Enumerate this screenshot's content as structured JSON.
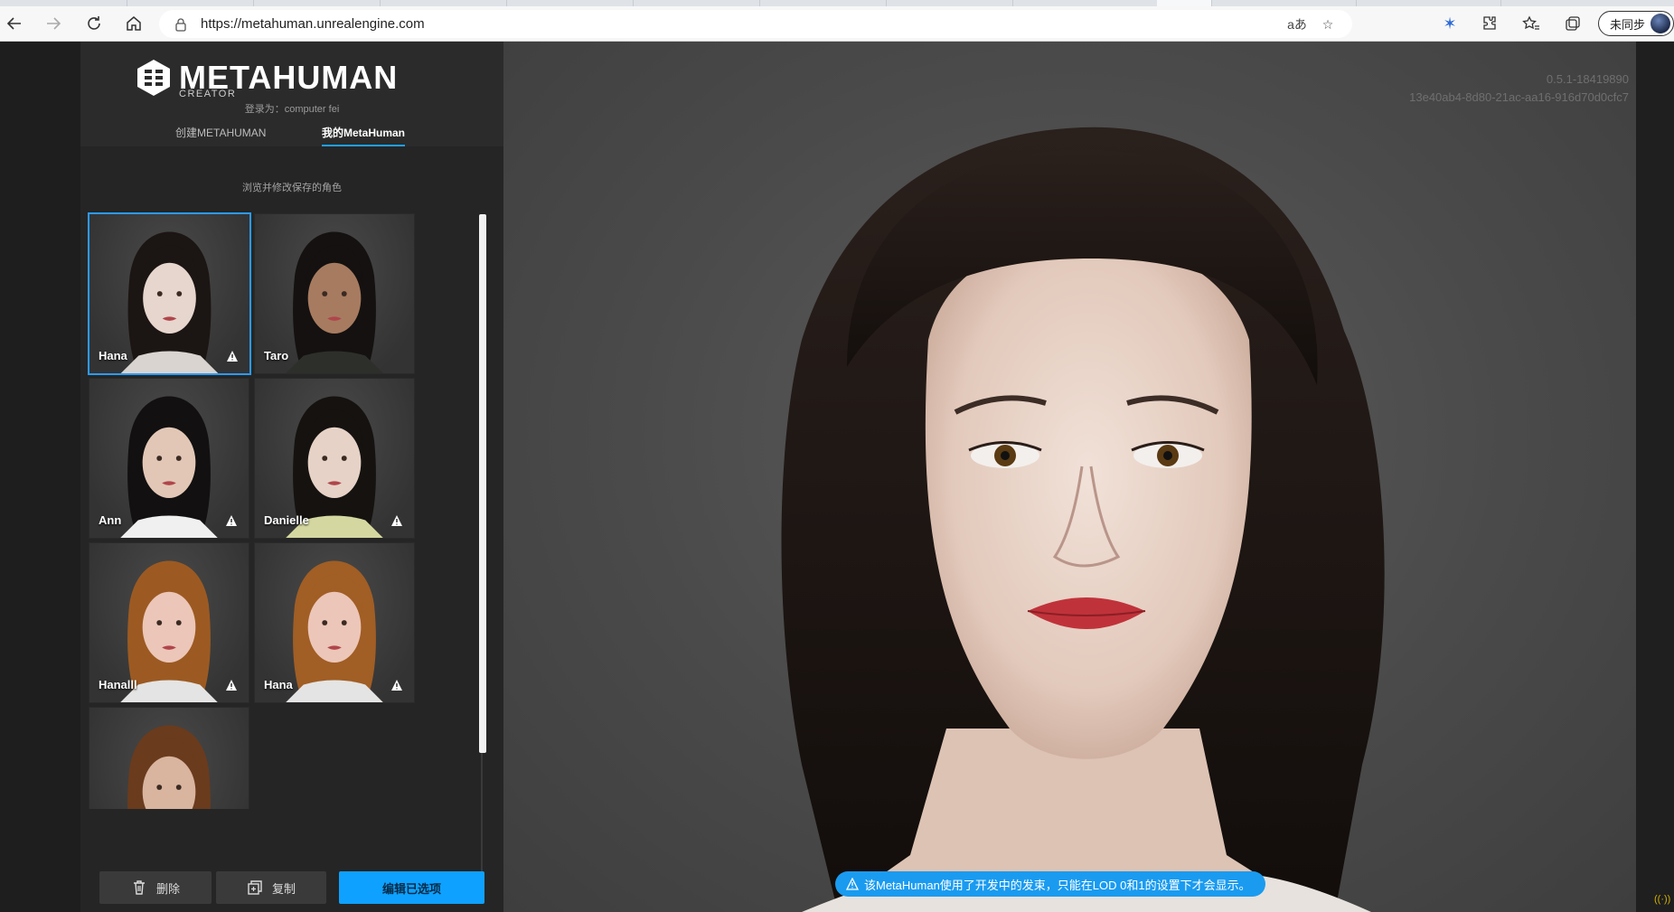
{
  "browser": {
    "url": "https://metahuman.unrealengine.com",
    "sync_label": "未同步"
  },
  "app": {
    "logo_text": "METAHUMAN",
    "logo_sub": "CREATOR",
    "login_text": "登录为：computer fei",
    "tabs": [
      {
        "label": "创建METAHUMAN",
        "active": false
      },
      {
        "label": "我的MetaHuman",
        "active": true
      }
    ],
    "subtitle": "浏览并修改保存的角色",
    "characters": [
      {
        "name": "Hana",
        "warning": true,
        "selected": true,
        "hair": "#1b1513",
        "skin": "#e6d6cd",
        "cloth": "#d9d4cf"
      },
      {
        "name": "Taro",
        "warning": false,
        "selected": false,
        "hair": "#141110",
        "skin": "#a77b60",
        "cloth": "#2d2f2b"
      },
      {
        "name": "Ann",
        "warning": true,
        "selected": false,
        "hair": "#121010",
        "skin": "#e2c7b6",
        "cloth": "#f0f0f0"
      },
      {
        "name": "Danielle",
        "warning": true,
        "selected": false,
        "hair": "#151210",
        "skin": "#e6d2c6",
        "cloth": "#d4d8a0"
      },
      {
        "name": "Hanalll",
        "warning": true,
        "selected": false,
        "hair": "#9c5a22",
        "skin": "#ecc6b8",
        "cloth": "#e4e4e4"
      },
      {
        "name": "Hana",
        "warning": true,
        "selected": false,
        "hair": "#a15e25",
        "skin": "#ecc6b8",
        "cloth": "#e4e4e4"
      },
      {
        "name": "",
        "warning": false,
        "selected": false,
        "hair": "#6a3b1d",
        "skin": "#d9b49e",
        "cloth": "#888888"
      }
    ],
    "buttons": {
      "delete": "删除",
      "duplicate": "复制",
      "edit": "编辑已选项"
    },
    "version_line1": "0.5.1-18419890",
    "version_line2": "13e40ab4-8d80-21ac-aa16-916d70d0cfc7",
    "notice": "该MetaHuman使用了开发中的发束，只能在LOD 0和1的设置下才会显示。"
  },
  "colors": {
    "accent": "#0ea1ff",
    "panel": "#252525",
    "viewport": "#4a4a4a"
  }
}
